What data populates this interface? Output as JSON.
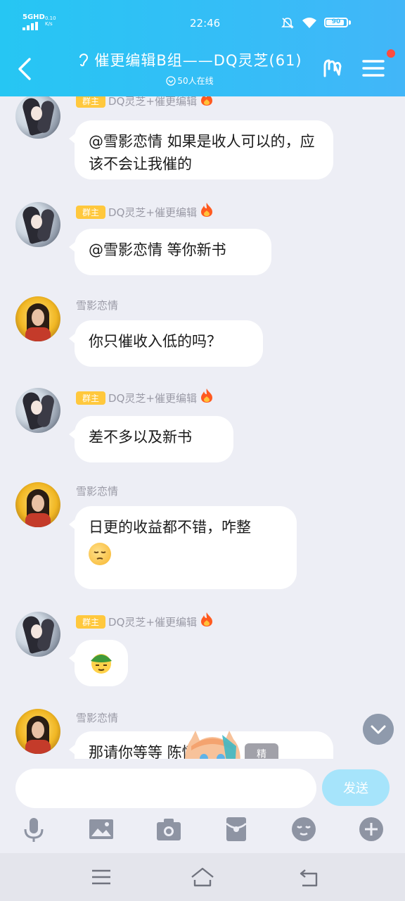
{
  "status_bar": {
    "network": "5GHD",
    "speed": "0.10 K/s",
    "time": "22:46",
    "battery": "90",
    "battery_level": 0.9
  },
  "header": {
    "title": "催更编辑B组——DQ灵芝(61)",
    "online": "50人在线"
  },
  "messages": [
    {
      "sender": "DQ灵芝+催更编辑",
      "role": "群主",
      "avatar": "owner",
      "text": "@雪影恋情 如果是收人可以的，应该不会让我催的"
    },
    {
      "sender": "DQ灵芝+催更编辑",
      "role": "群主",
      "avatar": "owner",
      "text": "@雪影恋情 等你新书"
    },
    {
      "sender": "雪影恋情",
      "role": "",
      "avatar": "member",
      "text": "你只催收入低的吗？"
    },
    {
      "sender": "DQ灵芝+催更编辑",
      "role": "群主",
      "avatar": "owner",
      "text": "差不多以及新书"
    },
    {
      "sender": "雪影恋情",
      "role": "",
      "avatar": "member",
      "text": "日更的收益都不错，咋整",
      "emoji": "pensive-emoji"
    },
    {
      "sender": "DQ灵芝+催更编辑",
      "role": "群主",
      "avatar": "owner",
      "text": "",
      "emoji": "turtle-emoji"
    },
    {
      "sender": "雪影恋情",
      "role": "",
      "avatar": "member",
      "text": "那请你等等 陈情令的"
    }
  ],
  "overlay": {
    "vote_label": "精"
  },
  "input": {
    "placeholder": "",
    "send_label": "发送"
  },
  "toolbar": [
    "mic-icon",
    "image-icon",
    "camera-icon",
    "red-packet-icon",
    "emoji-icon",
    "plus-icon"
  ],
  "nav": [
    "menu-nav-icon",
    "home-nav-icon",
    "back-nav-icon"
  ],
  "colors": {
    "header": "#36bdf7",
    "badge": "#ffc83d",
    "send": "#a6e4fb",
    "notify": "#ff4b3e"
  }
}
